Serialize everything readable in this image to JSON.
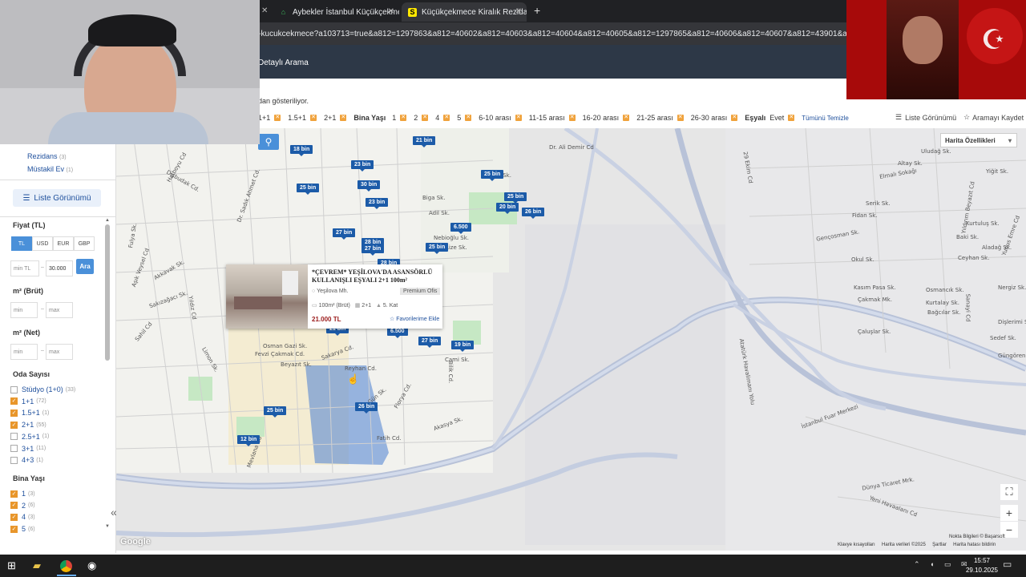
{
  "tabs": [
    {
      "label": "Aybekler İstanbul Küçükçekme"
    },
    {
      "label": "Küçükçekmece Kiralık Rezidans"
    }
  ],
  "address": "l-kucukcekmece?a103713=true&a812=1297863&a812=40602&a812=40603&a812=40604&a812=40605&a812=1297865&a812=40606&a812=40607&a812=43901&a812=4390",
  "nav": {
    "detailed_search": "Detaylı Arama"
  },
  "info_text": "dan gösteriliyor.",
  "filters": {
    "oda": [
      "1+1",
      "1.5+1",
      "2+1"
    ],
    "bina_label": "Bina Yaşı",
    "bina": [
      "1",
      "2",
      "4",
      "5",
      "6-10 arası",
      "11-15 arası",
      "16-20 arası",
      "21-25 arası",
      "26-30 arası"
    ],
    "esyali_label": "Eşyalı",
    "esyali": [
      "Evet"
    ],
    "clear": "Tümünü Temizle",
    "list_view": "Liste Görünümü",
    "save_search": "Aramayı Kaydet"
  },
  "sidebar": {
    "types": [
      {
        "label": "Rezidans",
        "count": "(3)"
      },
      {
        "label": "Müstakil Ev",
        "count": "(1)"
      }
    ],
    "list_view": "Liste Görünümü",
    "price_title": "Fiyat (TL)",
    "currencies": [
      "TL",
      "USD",
      "EUR",
      "GBP"
    ],
    "price_min_ph": "min TL",
    "price_max": "30.000",
    "go": "Ara",
    "m2_brut": "m² (Brüt)",
    "m2_net": "m² (Net)",
    "min_ph": "min",
    "max_ph": "max",
    "rooms_title": "Oda Sayısı",
    "rooms": [
      {
        "label": "Stüdyo (1+0)",
        "count": "(33)",
        "checked": false
      },
      {
        "label": "1+1",
        "count": "(72)",
        "checked": true
      },
      {
        "label": "1.5+1",
        "count": "(1)",
        "checked": true
      },
      {
        "label": "2+1",
        "count": "(55)",
        "checked": true
      },
      {
        "label": "2.5+1",
        "count": "(1)",
        "checked": false
      },
      {
        "label": "3+1",
        "count": "(11)",
        "checked": false
      },
      {
        "label": "4+3",
        "count": "(1)",
        "checked": false
      }
    ],
    "age_title": "Bina Yaşı",
    "ages": [
      {
        "label": "1",
        "count": "(3)",
        "checked": true
      },
      {
        "label": "2",
        "count": "(6)",
        "checked": true
      },
      {
        "label": "4",
        "count": "(3)",
        "checked": true
      },
      {
        "label": "5",
        "count": "(6)",
        "checked": true
      }
    ]
  },
  "map": {
    "options": "Harita Özellikleri",
    "pins": [
      "18 bin",
      "21 bin",
      "23 bin",
      "25 bin",
      "30 bin",
      "23 bin",
      "25 bin",
      "25 bin",
      "20 bin",
      "26 bin",
      "6.500",
      "27 bin",
      "28 bin",
      "27 bin",
      "25 bin",
      "28 bin",
      "21 bin",
      "6.500",
      "27 bin",
      "19 bin",
      "26 bin",
      "25 bin",
      "12 bin"
    ],
    "streets": [
      "Dr. Ali Demir Cd",
      "Tecan Sk.",
      "Biga Sk.",
      "Adil Sk.",
      "Nebioğlu Sk.",
      "Rize Sk.",
      "Osman Gazi Sk.",
      "Fevzi Çakmak Cd.",
      "Beyazıt Sk.",
      "Reyhan Cd.",
      "Sakarya Cd.",
      "Fatih Cd.",
      "Akasya Sk.",
      "Cami Sk.",
      "Gün Sk.",
      "Bilik Cd.",
      "Florya Cd.",
      "Atatürk Havalimanı Yolu",
      "İstanbul Fuar Merkezi",
      "Yeni Havaalanı Cd",
      "Dünya Ticaret Mrk.",
      "Gençosman Sk.",
      "Elmalı Sokağı",
      "Fidan Sk.",
      "Okul Sk.",
      "Çaluşlar Sk.",
      "Sanayi Cd",
      "29 Ekim Cd",
      "Uludağ Sk.",
      "Serik Sk.",
      "Altay Sk.",
      "Çakmak Mk.",
      "Kurtalay Sk.",
      "Bağcılar Sk.",
      "Kasım Pasa Sk.",
      "Mevlana Cd",
      "Akkavak Sk.",
      "Sakızağacı Sk.",
      "Dışbudak Cd.",
      "Dr. Sadık Ahmet Cd.",
      "Hatboyu Cd",
      "Fulya Sk.",
      "Aşık Veysel Cd",
      "Yıldız Cd",
      "Sahil Cd",
      "Limon Sk.",
      "Kurtuluş Sk.",
      "Yıldırım Beyazıt Cd",
      "Yunus Emre Cd",
      "Baki Sk.",
      "Ceyhan Sk.",
      "Osmancık Sk.",
      "Nergiz Sk.",
      "Dişlerimi Sk.",
      "Güngören Sk.",
      "Aladağ Sk.",
      "Yiğit Sk.",
      "Sedef Sk."
    ],
    "popup": {
      "title": "*ÇEVREM* YEŞİLOVA'DA ASANSÖRLÜ KULLANIŞLI EŞYALI 2+1 100m²",
      "location": "Yeşilova Mh.",
      "badge": "Premium Ofis",
      "area": "100m² (Brüt)",
      "rooms": "2+1",
      "floor": "5. Kat",
      "price": "21.000 TL",
      "fav": "Favorilerime Ekle"
    },
    "footer": [
      "Nokta Bilgileri © Başarsoft",
      "Klavye kısayolları",
      "Harita verileri ©2025",
      "Şartlar",
      "Harita hatası bildirin"
    ],
    "google": "Google"
  },
  "taskbar": {
    "time": "15:57",
    "date": "29.10.2025"
  },
  "colors": {
    "pin": "#1c5ba8",
    "highlight": "#4b7fd1",
    "nav": "#2d3847",
    "orange": "#e8962b"
  }
}
